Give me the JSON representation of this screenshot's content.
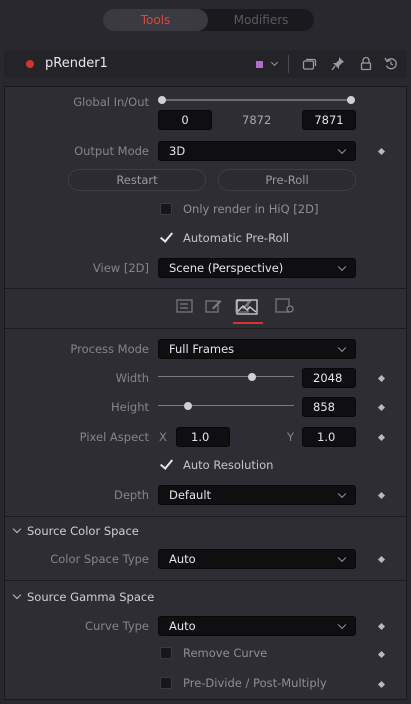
{
  "tabs": {
    "tools": "Tools",
    "modifiers": "Modifiers"
  },
  "header": {
    "tool_name": "pRender1",
    "swatch_color": "#b56ad0"
  },
  "global_in_out": {
    "label": "Global In/Out",
    "start": "0",
    "mid": "7872",
    "end": "7871"
  },
  "output_mode": {
    "label": "Output Mode",
    "value": "3D"
  },
  "buttons": {
    "restart": "Restart",
    "preroll": "Pre-Roll"
  },
  "checks": {
    "hiq": {
      "label": "Only render in HiQ [2D]",
      "checked": false
    },
    "auto_preroll": {
      "label": "Automatic Pre-Roll",
      "checked": true
    }
  },
  "view": {
    "label": "View [2D]",
    "value": "Scene (Perspective)"
  },
  "icon_tabs": [
    "controls-icon",
    "brush-icon",
    "brush-gear-icon",
    "image-icon",
    "settings-icon"
  ],
  "process_mode": {
    "label": "Process Mode",
    "value": "Full Frames"
  },
  "width": {
    "label": "Width",
    "value": "2048"
  },
  "height": {
    "label": "Height",
    "value": "858"
  },
  "pixel_aspect": {
    "label": "Pixel Aspect",
    "x_label": "X",
    "x_value": "1.0",
    "y_label": "Y",
    "y_value": "1.0"
  },
  "auto_resolution": {
    "label": "Auto Resolution",
    "checked": true
  },
  "depth": {
    "label": "Depth",
    "value": "Default"
  },
  "source_color_space": {
    "title": "Source Color Space",
    "type_label": "Color Space Type",
    "type_value": "Auto"
  },
  "source_gamma_space": {
    "title": "Source Gamma Space",
    "curve_label": "Curve Type",
    "curve_value": "Auto",
    "remove_curve": "Remove Curve",
    "predivide": "Pre-Divide / Post-Multiply"
  },
  "colors": {
    "accent_red": "#d6342b",
    "active_tab_underline": "#d6342b"
  }
}
